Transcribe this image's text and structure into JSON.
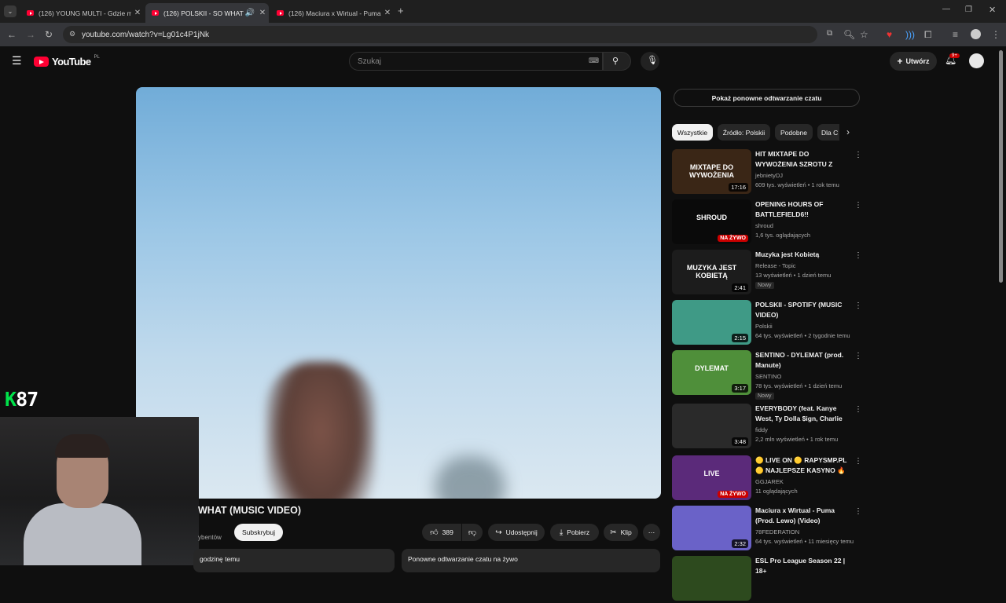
{
  "browser": {
    "tabs": [
      {
        "title": "(126) YOUNG MULTI - Gdzie m",
        "active": false
      },
      {
        "title": "(126) POLSKII - SO WHAT (",
        "active": true
      },
      {
        "title": "(126) Maciura x Wirtual - Puma",
        "active": false
      }
    ],
    "url": "youtube.com/watch?v=Lg01c4P1jNk"
  },
  "header": {
    "logo": "YouTube",
    "region": "PL",
    "search_placeholder": "Szukaj",
    "create_label": "Utwórz",
    "notifications": "9+"
  },
  "overlay": {
    "streamer_tag_k": "K",
    "streamer_tag_num": "87"
  },
  "video": {
    "title": "WHAT (MUSIC VIDEO)",
    "subscribers": "ybentów",
    "subscribe": "Subskrybuj",
    "likes": "389",
    "share": "Udostępnij",
    "download": "Pobierz",
    "clip": "Klip",
    "desc_left": "godzinę temu",
    "desc_right": "Ponowne odtwarzanie czatu na żywo"
  },
  "sidebar": {
    "chat_replay": "Pokaż ponowne odtwarzanie czatu",
    "chips": [
      "Wszystkie",
      "Źródło: Polskii",
      "Podobne",
      "Dla C"
    ],
    "recs": [
      {
        "title": "HIT MIXTAPE DO WYWOŻENIA SZROTU Z RYNK...",
        "channel": "jebnietyDJ",
        "meta": "609 tys. wyświetleń • 1 rok temu",
        "dur": "17:16",
        "thumb_text": "MIXTAPE DO WYWOŻENIA",
        "thumb_color": "#3a2616"
      },
      {
        "title": "OPENING HOURS OF BATTLEFIELD6!!",
        "channel": "shroud",
        "meta": "1,6 tys. oglądających",
        "live": "NA ŻYWO",
        "thumb_text": "SHROUD",
        "thumb_color": "#0a0a0a"
      },
      {
        "title": "Muzyka jest Kobietą",
        "channel": "Release - Topic",
        "meta": "13 wyświetleń • 1 dzień temu",
        "badge": "Nowy",
        "dur": "2:41",
        "thumb_text": "MUZYKA JEST KOBIETĄ",
        "thumb_color": "#1c1c1c"
      },
      {
        "title": "POLSKII - SPOTIFY (MUSIC VIDEO)",
        "channel": "Polskii",
        "meta": "64 tys. wyświetleń • 2 tygodnie temu",
        "dur": "2:15",
        "thumb_text": "",
        "thumb_color": "#3f9a86"
      },
      {
        "title": "SENTINO - DYLEMAT (prod. Manute)",
        "channel": "SENTINO",
        "meta": "78 tys. wyświetleń • 1 dzień temu",
        "badge": "Nowy",
        "dur": "3:17",
        "thumb_text": "DYLEMAT",
        "thumb_color": "#4f8f3a"
      },
      {
        "title": "EVERYBODY (feat. Kanye West, Ty Dolla $ign, Charlie Wilson)",
        "channel": "fiddy",
        "meta": "2,2 mln wyświetleń • 1 rok temu",
        "dur": "3:48",
        "thumb_text": "",
        "thumb_color": "#2a2a2a"
      },
      {
        "title": "🟡 LIVE ON 🟡 RAPYSMP.PL 🟡 NAJLEPSZE KASYNO 🔥 ...",
        "channel": "GGJAREK",
        "meta": "11 oglądających",
        "live": "NA ŻYWO",
        "thumb_text": "LIVE",
        "thumb_color": "#5b2a7a"
      },
      {
        "title": "Maciura x Wirtual - Puma (Prod. Lewo) (Video)",
        "channel": "78FEDERATION",
        "meta": "64 tys. wyświetleń • 11 miesięcy temu",
        "dur": "2:32",
        "thumb_text": "",
        "thumb_color": "#6a62c8"
      },
      {
        "title": "ESL Pro League Season 22 | 18+",
        "channel": "",
        "meta": "",
        "thumb_text": "",
        "thumb_color": "#2d4a1e"
      }
    ]
  }
}
